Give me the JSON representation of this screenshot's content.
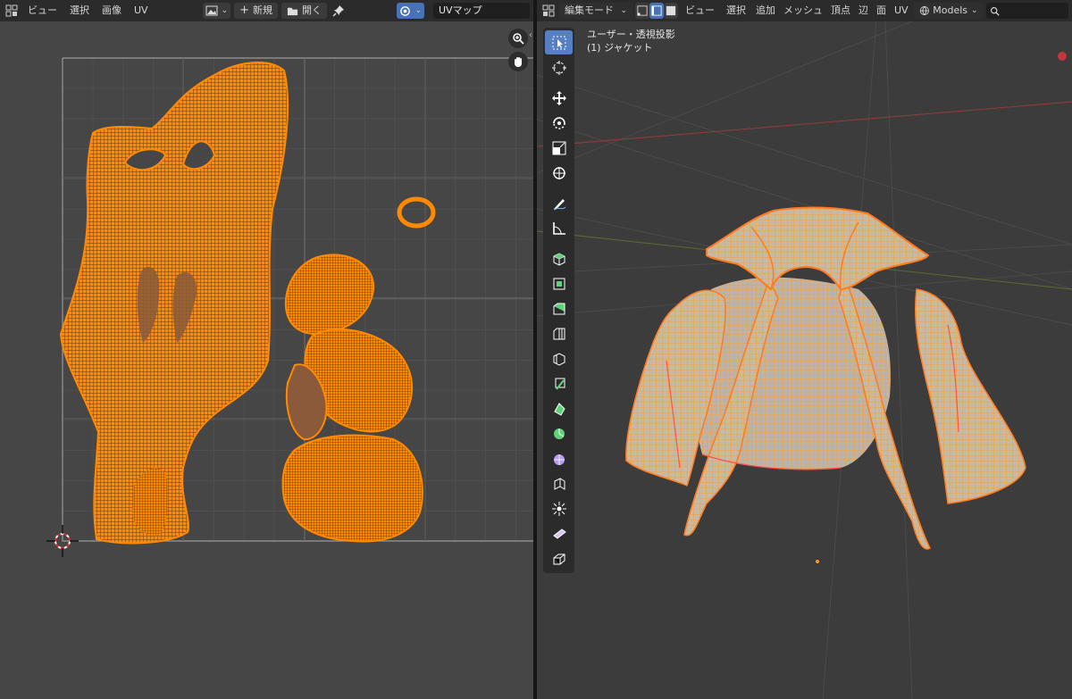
{
  "uv_editor": {
    "header": {
      "menus": [
        "ビュー",
        "選択",
        "画像",
        "UV"
      ],
      "new_label": "新規",
      "open_label": "開く",
      "uv_map_name": "UVマップ"
    }
  },
  "viewport": {
    "header": {
      "mode_label": "編集モード",
      "menus": [
        "ビュー",
        "選択",
        "追加",
        "メッシュ",
        "頂点",
        "辺",
        "面",
        "UV"
      ],
      "collection_label": "Models",
      "search_placeholder": ""
    },
    "overlay": {
      "view_name": "ユーザー・透視投影",
      "object_name": "(1) ジャケット"
    },
    "tools": [
      "select-box",
      "cursor",
      "move",
      "rotate",
      "scale",
      "transform",
      "annotate",
      "measure",
      "add-cube",
      "extrude-region",
      "inset-faces",
      "bevel",
      "loop-cut",
      "knife",
      "poly-build",
      "spin",
      "smooth",
      "edge-slide",
      "shrink-fatten",
      "shear",
      "rip-region"
    ]
  },
  "colors": {
    "uv_mesh": "#ff8a00",
    "active_tool": "#5680c2",
    "editor_bg": "#464646",
    "viewport_bg": "#3c3c3c"
  }
}
